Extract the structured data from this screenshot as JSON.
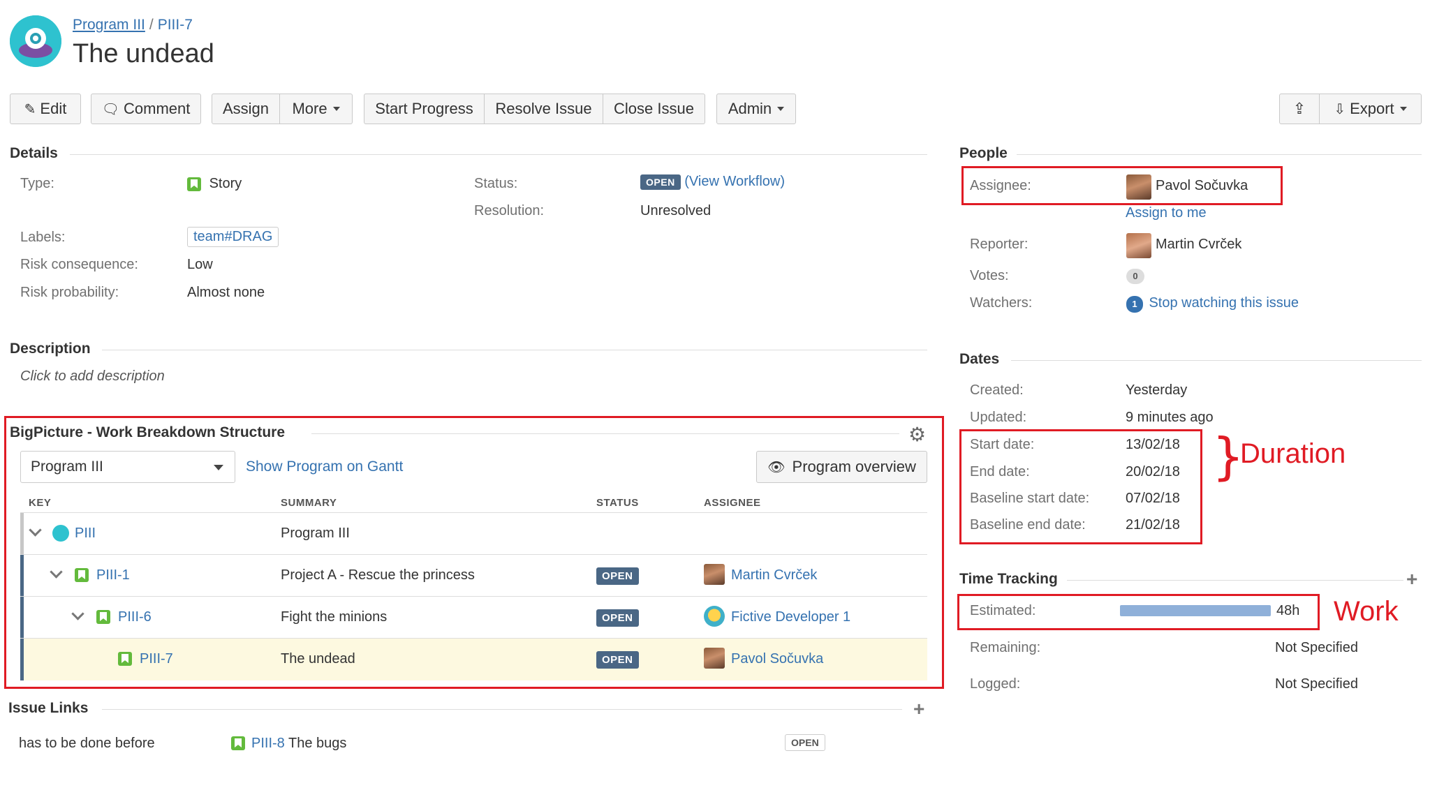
{
  "header": {
    "breadcrumb": [
      "Program III",
      "PIII-7"
    ],
    "breadcrumb_sep": "/",
    "title": "The undead"
  },
  "toolbar": {
    "edit": "Edit",
    "comment": "Comment",
    "assign": "Assign",
    "more": "More",
    "start_progress": "Start Progress",
    "resolve_issue": "Resolve Issue",
    "close_issue": "Close Issue",
    "admin": "Admin",
    "export": "Export"
  },
  "details": {
    "heading": "Details",
    "type_label": "Type:",
    "type_value": "Story",
    "status_label": "Status:",
    "status_value": "OPEN",
    "view_workflow": "View Workflow",
    "resolution_label": "Resolution:",
    "resolution_value": "Unresolved",
    "labels_label": "Labels:",
    "labels_value": "team#DRAG",
    "risk_consequence_label": "Risk consequence:",
    "risk_consequence_value": "Low",
    "risk_probability_label": "Risk probability:",
    "risk_probability_value": "Almost none"
  },
  "description": {
    "heading": "Description",
    "placeholder": "Click to add description"
  },
  "wbs": {
    "heading": "BigPicture - Work Breakdown Structure",
    "program_select": "Program III",
    "show_gantt": "Show Program on Gantt",
    "program_overview": "Program overview",
    "columns": [
      "KEY",
      "SUMMARY",
      "STATUS",
      "ASSIGNEE"
    ],
    "rows": [
      {
        "key": "PIII",
        "summary": "Program III",
        "status": "",
        "assignee": ""
      },
      {
        "key": "PIII-1",
        "summary": "Project A - Rescue the princess",
        "status": "OPEN",
        "assignee": "Martin Cvrček"
      },
      {
        "key": "PIII-6",
        "summary": "Fight the minions",
        "status": "OPEN",
        "assignee": "Fictive Developer 1"
      },
      {
        "key": "PIII-7",
        "summary": "The undead",
        "status": "OPEN",
        "assignee": "Pavol Sočuvka"
      }
    ]
  },
  "issue_links": {
    "heading": "Issue Links",
    "relation": "has to be done before",
    "linked_key": "PIII-8",
    "linked_summary": "The bugs",
    "linked_status": "OPEN"
  },
  "people": {
    "heading": "People",
    "assignee_label": "Assignee:",
    "assignee_value": "Pavol Sočuvka",
    "assign_to_me": "Assign to me",
    "reporter_label": "Reporter:",
    "reporter_value": "Martin Cvrček",
    "votes_label": "Votes:",
    "votes_value": "0",
    "watchers_label": "Watchers:",
    "watchers_count": "1",
    "stop_watching": "Stop watching this issue"
  },
  "dates": {
    "heading": "Dates",
    "created_label": "Created:",
    "created_value": "Yesterday",
    "updated_label": "Updated:",
    "updated_value": "9 minutes ago",
    "start_label": "Start date:",
    "start_value": "13/02/18",
    "end_label": "End date:",
    "end_value": "20/02/18",
    "baseline_start_label": "Baseline start date:",
    "baseline_start_value": "07/02/18",
    "baseline_end_label": "Baseline end date:",
    "baseline_end_value": "21/02/18"
  },
  "time_tracking": {
    "heading": "Time Tracking",
    "estimated_label": "Estimated:",
    "estimated_value": "48h",
    "estimated_fill": 1.0,
    "remaining_label": "Remaining:",
    "remaining_value": "Not Specified",
    "logged_label": "Logged:",
    "logged_value": "Not Specified"
  },
  "annotations": {
    "duration": "Duration",
    "work": "Work"
  },
  "colors": {
    "annotation_red": "#e01b24",
    "link_blue": "#3572b0",
    "status_open": "#4a6785",
    "story_green": "#63ba3c",
    "highlight_row": "#fdf9e0"
  }
}
